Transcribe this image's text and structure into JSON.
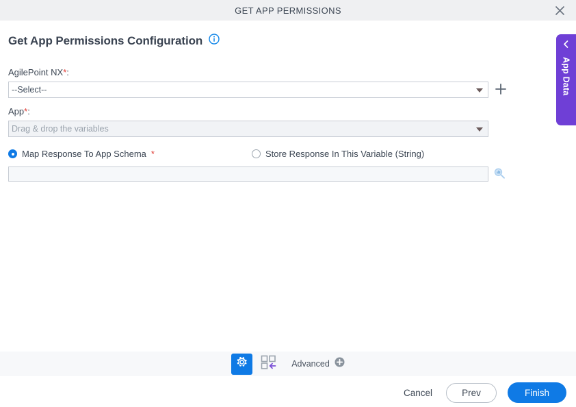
{
  "window": {
    "title": "GET APP PERMISSIONS",
    "close_icon": "close-icon"
  },
  "heading": {
    "title": "Get App Permissions Configuration",
    "info_icon": "info-icon"
  },
  "form": {
    "agilepoint": {
      "label": "AgilePoint NX",
      "required_mark": "*",
      "colon": ":",
      "value": "--Select--",
      "dropdown_icon": "chevron-down-icon",
      "add_icon": "plus-icon"
    },
    "app": {
      "label": "App",
      "required_mark": "*",
      "colon": ":",
      "placeholder": "Drag & drop the variables",
      "value": "Drag & drop the variables",
      "dropdown_icon": "chevron-down-icon"
    },
    "response_mode": {
      "option_map": {
        "label": "Map Response To App Schema",
        "required_mark": "*",
        "selected": true
      },
      "option_store": {
        "label": "Store Response In This Variable (String)",
        "selected": false
      }
    },
    "response_value": {
      "value": "",
      "placeholder": "",
      "search_icon": "search-icon"
    }
  },
  "app_data_panel": {
    "label": "App Data",
    "collapse_icon": "chevron-left-icon"
  },
  "toolbar": {
    "settings_icon": "gear-icon",
    "layout_icon": "layout-arrow-icon",
    "advanced_label": "Advanced",
    "advanced_add_icon": "plus-circle-icon"
  },
  "footer": {
    "cancel_label": "Cancel",
    "prev_label": "Prev",
    "finish_label": "Finish"
  },
  "colors": {
    "accent_blue": "#0f7ae5",
    "purple": "#6f3fd6",
    "required_red": "#e03b34",
    "header_gray": "#eff0f2",
    "toolbar_gray": "#f7f8fa"
  }
}
